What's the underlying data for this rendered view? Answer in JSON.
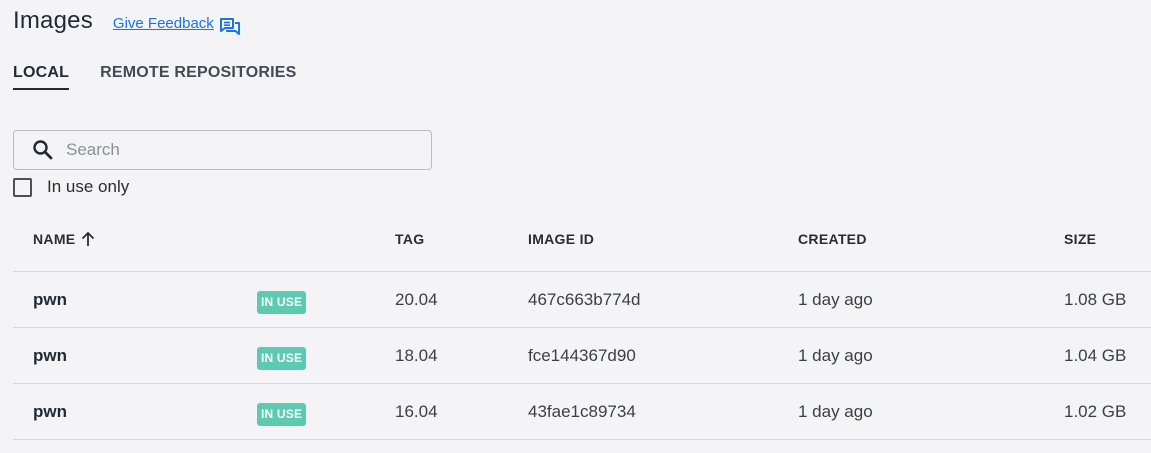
{
  "header": {
    "title": "Images",
    "feedback_label": "Give Feedback",
    "feedback_icon": "feedback-icon"
  },
  "tabs": [
    {
      "label": "LOCAL",
      "active": true
    },
    {
      "label": "REMOTE REPOSITORIES",
      "active": false
    }
  ],
  "search": {
    "placeholder": "Search",
    "value": "",
    "icon": "search-icon"
  },
  "filter": {
    "label": "In use only",
    "checked": false
  },
  "table": {
    "columns": {
      "name": "NAME",
      "tag": "TAG",
      "image_id": "IMAGE ID",
      "created": "CREATED",
      "size": "SIZE"
    },
    "sort_icon": "arrow-up-icon",
    "rows": [
      {
        "name": "pwn",
        "badge": "IN USE",
        "tag": "20.04",
        "image_id": "467c663b774d",
        "created": "1 day ago",
        "size": "1.08 GB"
      },
      {
        "name": "pwn",
        "badge": "IN USE",
        "tag": "18.04",
        "image_id": "fce144367d90",
        "created": "1 day ago",
        "size": "1.04 GB"
      },
      {
        "name": "pwn",
        "badge": "IN USE",
        "tag": "16.04",
        "image_id": "43fae1c89734",
        "created": "1 day ago",
        "size": "1.02 GB"
      }
    ]
  },
  "colors": {
    "accent_link": "#1a73e8",
    "badge_bg": "#5acbb1",
    "background": "#f4f4f6"
  }
}
